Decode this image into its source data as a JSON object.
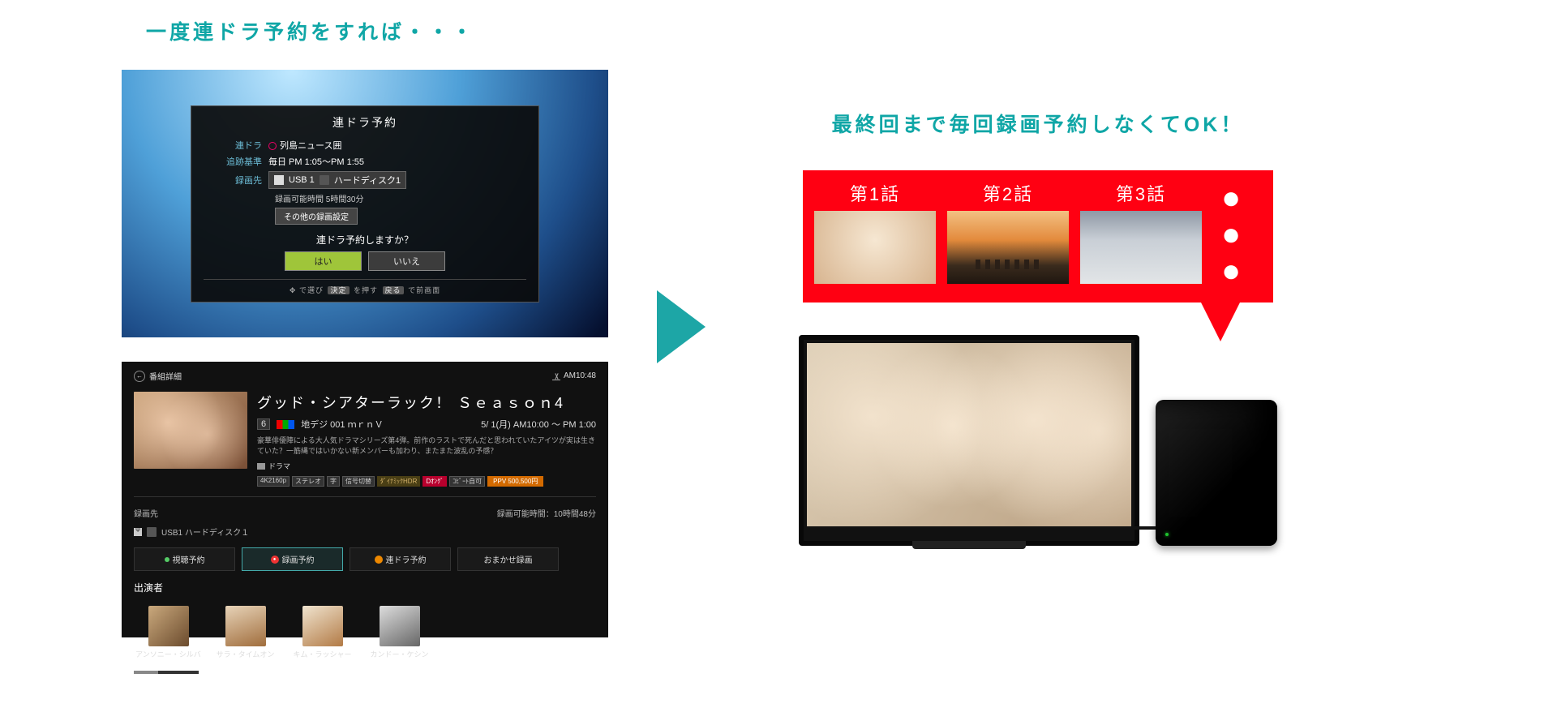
{
  "left_caption": "一度連ドラ予約をすれば・・・",
  "right_caption": "最終回まで毎回録画予約しなくてOK！",
  "dialog1": {
    "title": "連ドラ予約",
    "program_label": "連ドラ",
    "program_value": "列島ニュース囲",
    "criteria_label": "追跡基準",
    "criteria_value": "毎日  PM 1:05～PM 1:55",
    "dest_label": "録画先",
    "dest_usb": "USB 1",
    "dest_disk": "ハードディスク1",
    "remaining": "録画可能時間  5時間30分",
    "other_settings": "その他の録画設定",
    "question": "連ドラ予約しますか？",
    "yes": "はい",
    "no": "いいえ",
    "hints_select": "で選び",
    "hints_decide_key": "決定",
    "hints_decide_tail": "を押す",
    "hints_back_key": "戻る",
    "hints_back_tail": "で前画面"
  },
  "detail": {
    "top_label": "番組詳細",
    "clock": "AM10:48",
    "title": "グッド・シアターラック！  Ｓｅａｓｏｎ4",
    "ch_num": "6",
    "ch_name": "地デジ 001 ｍｒｎＶ",
    "datetime": "5/ 1(月)  AM10:00 ～ PM 1:00",
    "desc": "豪華俳優陣による大人気ドラマシリーズ第4弾。前作のラストで死んだと思われていたアイツが実は生きていた？一筋縄ではいかない新メンバーも加わり、またまた波乱の予感？",
    "genre": "ドラマ",
    "badges": [
      "4K2160p",
      "ステレオ",
      "字",
      "信号切替",
      "ﾀﾞｲﾅﾐｯｸHDR",
      "Dｵﾝｸﾞ",
      "ｺﾋﾟｰﾄ自可",
      "PPV 500,500円"
    ],
    "dest_label": "録画先",
    "dest_value": "USB1   ハードディスク１",
    "remaining": "録画可能時間：10時間48分",
    "actions": {
      "watch": "視聴予約",
      "record": "録画予約",
      "series": "連ドラ予約",
      "auto": "おまかせ録画"
    },
    "cast_label": "出演者",
    "cast": [
      "アンソニー・シルバ",
      "サラ・タイムオン",
      "キム・ラッシャー",
      "カンドー・ケシン"
    ]
  },
  "episodes": {
    "e1": "第1話",
    "e2": "第2話",
    "e3": "第3話",
    "more": "● ● ●"
  }
}
